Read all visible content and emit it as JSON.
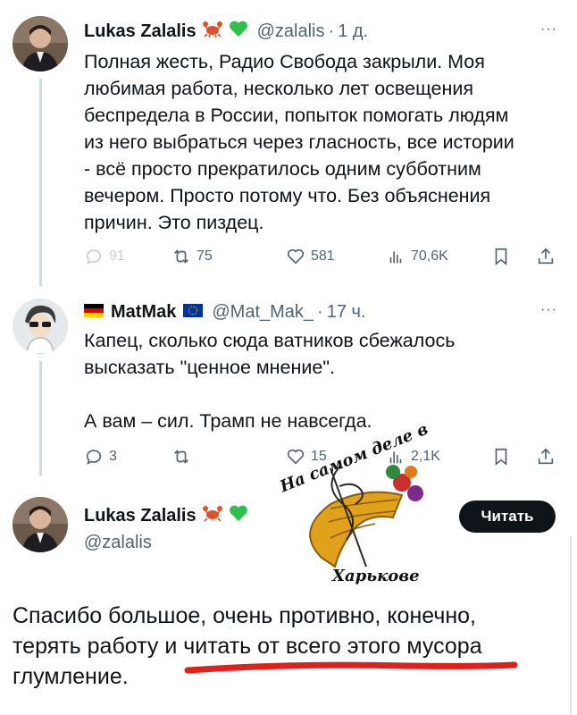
{
  "tweets": [
    {
      "name": "Lukas Zalalis",
      "badges": [
        "crab-emoji",
        "green-heart-emoji"
      ],
      "handle": "@zalalis",
      "sep": "·",
      "time": "1 д.",
      "more": "···",
      "text": "Полная жесть, Радио Свобода закрыли. Моя\nлюбимая работа, несколько лет освещения\nбеспредела в России, попыток помогать людям\nиз него выбраться через гласность, все истории\n- всё просто прекратилось одним субботним\nвечером. Просто потому что. Без объяснения\nпричин. Это пиздец.",
      "stats": {
        "replies": "91",
        "retweets": "75",
        "likes": "581",
        "views": "70,6K"
      }
    },
    {
      "name": "MatMak",
      "badges": [
        "germany-flag-emoji",
        "eu-flag-emoji"
      ],
      "handle": "@Mat_Mak_",
      "sep": "·",
      "time": "17 ч.",
      "more": "···",
      "text": "Капец, сколько сюда ватников сбежалось\nвысказать \"ценное мнение\".\n\nА вам – сил. Трамп не навсегда.",
      "stats": {
        "replies": "3",
        "retweets": "",
        "likes": "15",
        "views": "2,1K"
      }
    }
  ],
  "main_tweet": {
    "name": "Lukas Zalalis",
    "badges": [
      "crab-emoji",
      "green-heart-emoji"
    ],
    "handle": "@zalalis",
    "follow_label": "Читать",
    "text": "Спасибо большое, очень противно, конечно,\nтерять работу и читать от всего этого мусора\nглумление."
  },
  "watermark": {
    "line1": "На самом деле в",
    "line2": "Харькове"
  },
  "colors": {
    "text": "#0f1419",
    "secondary": "#536471",
    "verified_green": "#2fbf4a",
    "underline_red": "#e0201c"
  }
}
